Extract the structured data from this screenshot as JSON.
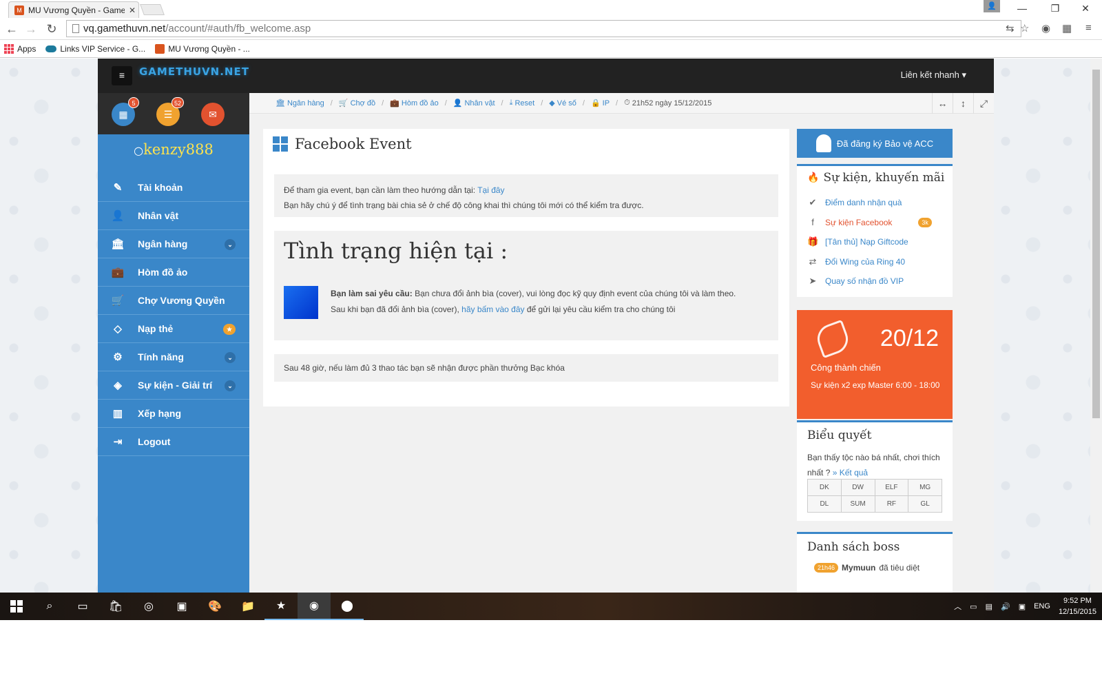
{
  "browser": {
    "tab_title": "MU Vương Quyền - Game",
    "url_host": "vq.gamethuvn.net",
    "url_path": "/account/#auth/fb_welcome.asp",
    "bookmarks": [
      "Apps",
      "Links VIP Service - G...",
      "MU Vương Quyền - ..."
    ]
  },
  "site": {
    "logo": "GAMETHUVN.NET",
    "quick_links": "Liên kết nhanh",
    "badges": {
      "calendar": "5",
      "messages": "52"
    },
    "username": "kenzy888",
    "menu": [
      {
        "label": "Tài khoản",
        "icon": "edit-icon"
      },
      {
        "label": "Nhân vật",
        "icon": "user-icon"
      },
      {
        "label": "Ngân hàng",
        "icon": "bank-icon"
      },
      {
        "label": "Hòm đồ ảo",
        "icon": "briefcase-icon"
      },
      {
        "label": "Chợ Vương Quyền",
        "icon": "cart-icon"
      },
      {
        "label": "Nạp thẻ",
        "icon": "diamond-icon"
      },
      {
        "label": "Tính năng",
        "icon": "gears-icon"
      },
      {
        "label": "Sự kiện - Giải trí",
        "icon": "event-icon"
      },
      {
        "label": "Xếp hạng",
        "icon": "chart-icon"
      },
      {
        "label": "Logout",
        "icon": "logout-icon"
      }
    ],
    "breadcrumb": [
      "Ngân hàng",
      "Chợ đồ",
      "Hòm đồ ảo",
      "Nhân vật",
      "Reset",
      "Vé số",
      "IP"
    ],
    "time": "21h52 ngày 15/12/2015"
  },
  "main": {
    "title": "Facebook Event",
    "note1_line1": "Để tham gia event, bạn cần làm theo hướng dẫn tại:",
    "note1_link": "Tại đây",
    "note1_line2": "Bạn hãy chú ý để tình trạng bài chia sẻ ở chế độ công khai thì chúng tôi mới có thể kiểm tra được.",
    "status_title": "Tình trạng hiện tại :",
    "error_label": "Bạn làm sai yêu cầu:",
    "error_text": "Bạn chưa đổi ảnh bìa (cover), vui lòng đọc kỹ quy định event của chúng tôi và làm theo.",
    "after_text": "Sau khi bạn đã đổi ảnh bìa (cover),",
    "after_link": "hãy bấm vào đây",
    "after_tail": "để gửi lại yêu cầu kiểm tra cho chúng tôi",
    "note2": "Sau 48 giờ, nếu làm đủ 3 thao tác bạn sẽ nhận được phần thưởng Bạc khóa"
  },
  "right": {
    "protect_button": "Đã đăng ký Bảo vệ ACC",
    "events_title": "Sự kiện, khuyến mãi",
    "events": [
      {
        "label": "Điểm danh nhận quà",
        "icon": "check-circle-icon"
      },
      {
        "label": "Sự kiện Facebook",
        "icon": "facebook-icon",
        "badge": "3k"
      },
      {
        "label": "[Tân thủ] Nạp Giftcode",
        "icon": "gift-icon"
      },
      {
        "label": "Đổi Wing của Ring 40",
        "icon": "exchange-icon"
      },
      {
        "label": "Quay số nhận đồ VIP",
        "icon": "send-icon"
      }
    ],
    "castle_date": "20/12",
    "castle_line1": "Công thành chiến",
    "castle_line2": "Sự kiện x2 exp Master 6:00 - 18:00",
    "vote_title": "Biểu quyết",
    "vote_question": "Bạn thấy tộc nào bá nhất, chơi thích nhất ?",
    "vote_result": "» Kết quả",
    "classes": [
      "DK",
      "DW",
      "ELF",
      "MG",
      "DL",
      "SUM",
      "RF",
      "GL"
    ],
    "boss_title": "Danh sách boss",
    "boss_time": "21h46",
    "boss_name": "Mymuun",
    "boss_text": "đã tiêu diệt"
  },
  "taskbar": {
    "lang": "ENG",
    "time": "9:52 PM",
    "date": "12/15/2015"
  }
}
